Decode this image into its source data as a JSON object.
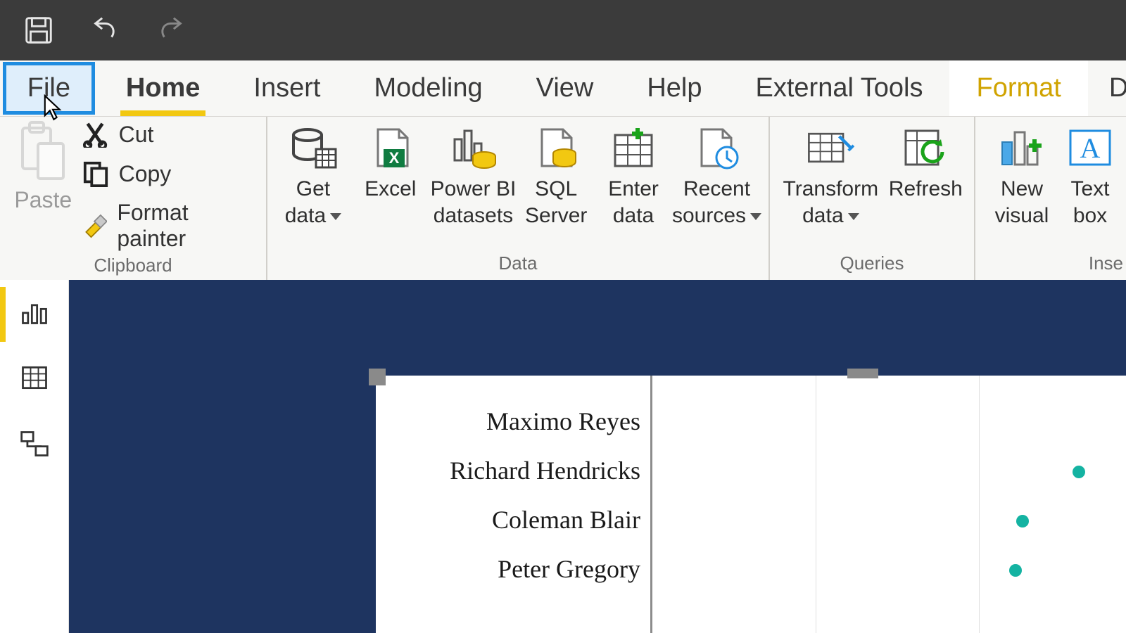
{
  "tabs": {
    "file": "File",
    "home": "Home",
    "insert": "Insert",
    "modeling": "Modeling",
    "view": "View",
    "help": "Help",
    "external": "External Tools",
    "format": "Format",
    "cutoff": "Da"
  },
  "clipboard": {
    "paste": "Paste",
    "cut": "Cut",
    "copy": "Copy",
    "format_painter": "Format painter",
    "group": "Clipboard"
  },
  "data": {
    "get_l1": "Get",
    "get_l2": "data",
    "excel": "Excel",
    "pbi_l1": "Power BI",
    "pbi_l2": "datasets",
    "sql_l1": "SQL",
    "sql_l2": "Server",
    "enter_l1": "Enter",
    "enter_l2": "data",
    "recent_l1": "Recent",
    "recent_l2": "sources",
    "group": "Data"
  },
  "queries": {
    "transform_l1": "Transform",
    "transform_l2": "data",
    "refresh": "Refresh",
    "group": "Queries"
  },
  "insert_group": {
    "newvis_l1": "New",
    "newvis_l2": "visual",
    "textbox_l1": "Text",
    "textbox_l2": "box",
    "group": "Inse"
  },
  "chart_data": {
    "type": "scatter",
    "categories": [
      "Maximo Reyes",
      "Richard Hendricks",
      "Coleman Blair",
      "Peter Gregory"
    ],
    "point_x_estimate": [
      null,
      0.92,
      0.8,
      0.79
    ],
    "title": "",
    "xlabel": "",
    "ylabel": "",
    "note": "x positions are rough fractions of visible plot width; first row has no visible point in frame"
  },
  "colors": {
    "accent": "#f2c811",
    "selection": "#1f8ce0",
    "canvas": "#1e3460",
    "dot": "#14b3a2"
  }
}
